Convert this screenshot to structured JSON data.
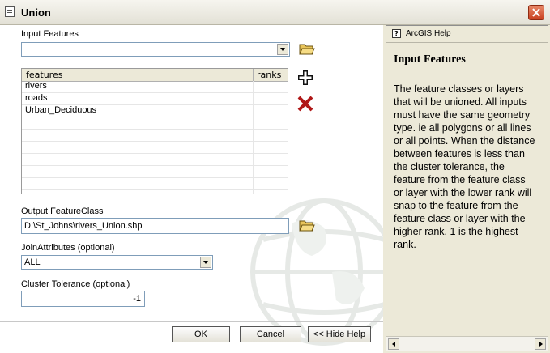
{
  "window": {
    "title": "Union"
  },
  "form": {
    "input_features_label": "Input Features",
    "input_features_value": "",
    "grid_headers": {
      "features": "features",
      "ranks": "ranks"
    },
    "grid_rows": [
      {
        "feature": "rivers",
        "rank": ""
      },
      {
        "feature": "roads",
        "rank": ""
      },
      {
        "feature": "Urban_Deciduous",
        "rank": ""
      },
      {
        "feature": "",
        "rank": ""
      },
      {
        "feature": "",
        "rank": ""
      },
      {
        "feature": "",
        "rank": ""
      },
      {
        "feature": "",
        "rank": ""
      },
      {
        "feature": "",
        "rank": ""
      },
      {
        "feature": "",
        "rank": ""
      }
    ],
    "output_label": "Output FeatureClass",
    "output_value": "D:\\St_Johns\\rivers_Union.shp",
    "join_label": "JoinAttributes (optional)",
    "join_value": "ALL",
    "tolerance_label": "Cluster Tolerance (optional)",
    "tolerance_value": "-1"
  },
  "buttons": {
    "ok": "OK",
    "cancel": "Cancel",
    "hide_help": "<< Hide Help"
  },
  "help": {
    "title": "ArcGIS Help",
    "heading": "Input Features",
    "body": "The feature classes or layers that will be unioned. All inputs must have the same geometry type. ie all polygons or all lines or all points. When the distance between features is less than the cluster tolerance, the feature from the feature class or layer with the lower rank will snap to the feature from the feature class or layer with the higher rank. 1 is the highest rank."
  },
  "icons": {
    "app": "document-icon",
    "close": "close-icon",
    "folder": "open-folder-icon",
    "add": "add-plus-icon",
    "remove": "remove-x-icon",
    "help": "help-question-icon"
  },
  "colors": {
    "close_button": "#c9401f",
    "remove_icon": "#b01818",
    "panel": "#ece9d8"
  }
}
